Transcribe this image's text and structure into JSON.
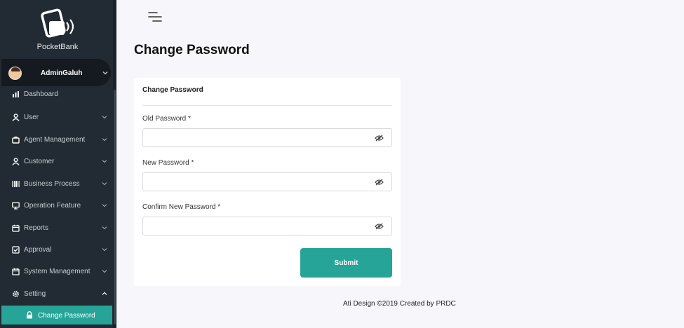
{
  "sidebar": {
    "brand": "PocketBank",
    "user": {
      "name": "AdminGaluh"
    },
    "items": [
      {
        "label": "Dashboard",
        "icon": "bar-chart-icon"
      },
      {
        "label": "User",
        "icon": "user-icon"
      },
      {
        "label": "Agent Management",
        "icon": "briefcase-icon"
      },
      {
        "label": "Customer",
        "icon": "user-icon"
      },
      {
        "label": "Business Process",
        "icon": "barcode-icon"
      },
      {
        "label": "Operation Feature",
        "icon": "monitor-icon"
      },
      {
        "label": "Reports",
        "icon": "calendar-icon"
      },
      {
        "label": "Approval",
        "icon": "check-square-icon"
      },
      {
        "label": "System Management",
        "icon": "calendar-icon"
      },
      {
        "label": "Setting",
        "icon": "gear-icon"
      }
    ],
    "active_subitem": {
      "label": "Change Password",
      "icon": "lock-icon"
    }
  },
  "page": {
    "title": "Change Password"
  },
  "form": {
    "card_title": "Change Password",
    "fields": [
      {
        "label": "Old Password *",
        "value": ""
      },
      {
        "label": "New Password *",
        "value": ""
      },
      {
        "label": "Confirm New Password *",
        "value": ""
      }
    ],
    "submit_label": "Submit"
  },
  "footer": {
    "text": "Ati Design ©2019 Created by PRDC"
  },
  "colors": {
    "sidebar": "#222b33",
    "accent": "#26a497",
    "background": "#f7f7fb"
  }
}
